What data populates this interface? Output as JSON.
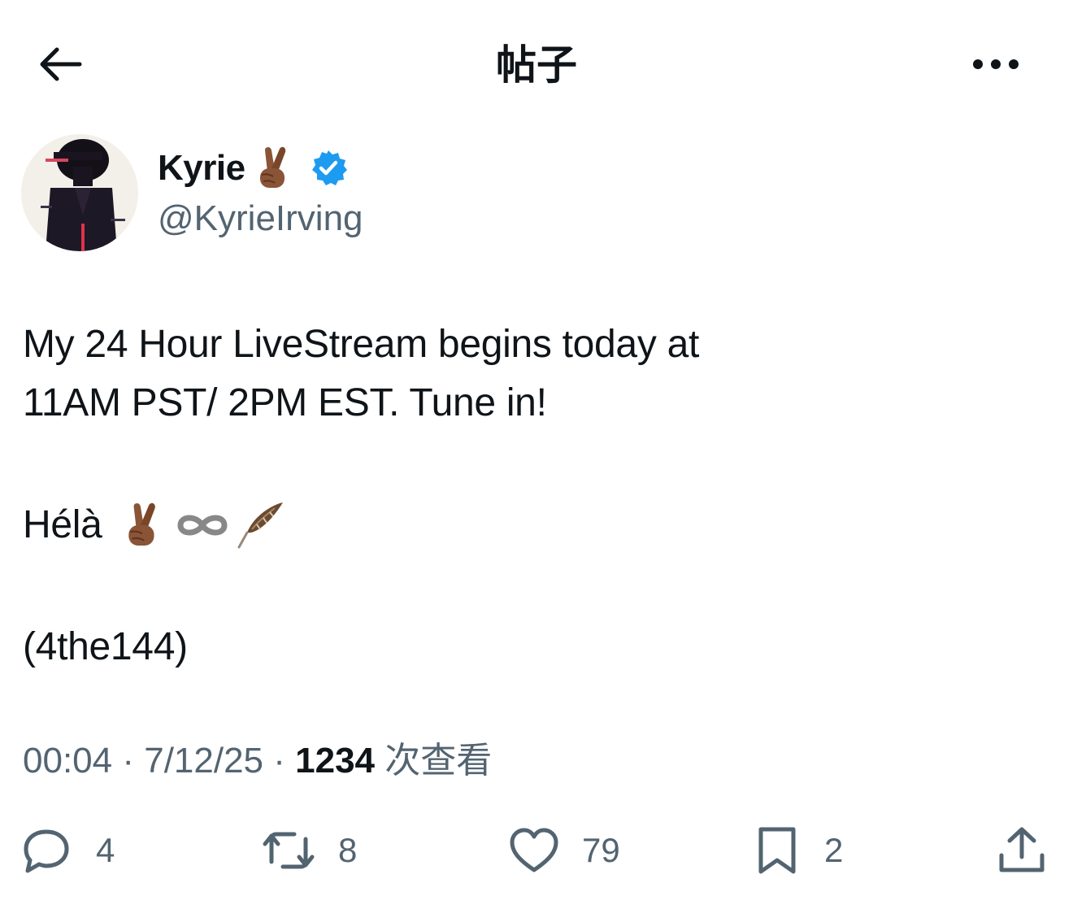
{
  "header": {
    "title": "帖子"
  },
  "author": {
    "name": "Kyrie",
    "handle": "@KyrieIrving",
    "name_emoji": "crossed-fingers-icon",
    "verified": true,
    "verified_color": "#1d9bf0"
  },
  "tweet": {
    "line1": "My 24 Hour LiveStream begins today at",
    "line2": "11AM PST/ 2PM EST. Tune in!",
    "line3_text": "Hélà",
    "line3_emojis": [
      "crossed-fingers-icon",
      "infinity-icon",
      "feather-icon"
    ],
    "line4": "(4the144)"
  },
  "meta": {
    "time": "00:04",
    "sep1": " · ",
    "date": "7/12/25",
    "sep2": " · ",
    "views": "1234",
    "views_label": " 次查看"
  },
  "actions": {
    "replies": "4",
    "reposts": "8",
    "likes": "79",
    "bookmarks": "2"
  },
  "colors": {
    "text": "#0f1419",
    "secondary": "#536471",
    "accent": "#1d9bf0"
  }
}
